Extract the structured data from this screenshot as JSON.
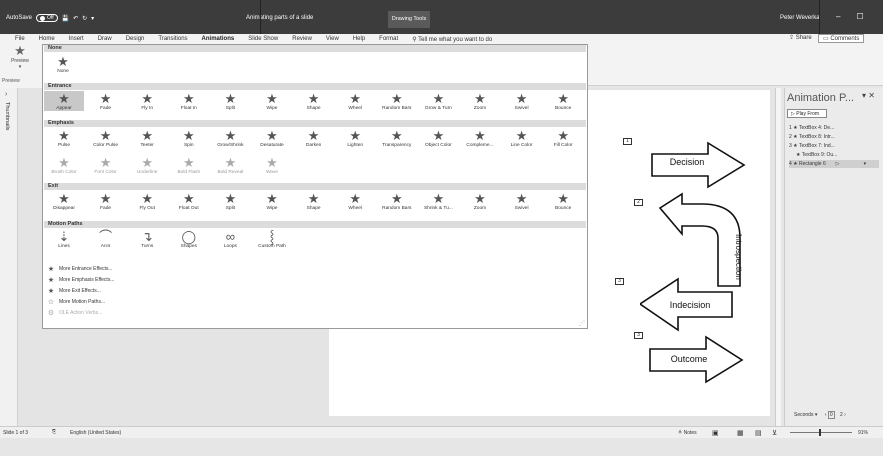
{
  "titlebar": {
    "autosave": "AutoSave",
    "toggle": "Off",
    "doc_title": "Animating parts of a slide",
    "drawing_tools": "Drawing Tools",
    "user": "Peter Weverka"
  },
  "menu": {
    "items": [
      "File",
      "Home",
      "Insert",
      "Draw",
      "Design",
      "Transitions",
      "Animations",
      "Slide Show",
      "Review",
      "View",
      "Help",
      "Format"
    ],
    "tell_me": "Tell me what you want to do",
    "share": "Share",
    "comments": "Comments"
  },
  "ribbon": {
    "preview": "Preview",
    "preview_group": "Preview"
  },
  "gallery": {
    "sections": {
      "none": "None",
      "entrance": "Entrance",
      "emphasis": "Emphasis",
      "exit": "Exit",
      "motion_paths": "Motion Paths"
    },
    "none_label": "None",
    "entrance": [
      "Appear",
      "Fade",
      "Fly In",
      "Float In",
      "Split",
      "Wipe",
      "Shape",
      "Wheel",
      "Random Bars",
      "Grow & Turn",
      "Zoom",
      "Swivel",
      "Bounce"
    ],
    "emphasis_row1": [
      "Pulse",
      "Color Pulse",
      "Teeter",
      "Spin",
      "Grow/Shrink",
      "Desaturate",
      "Darken",
      "Lighten",
      "Transparency",
      "Object Color",
      "Compleme...",
      "Line Color",
      "Fill Color"
    ],
    "emphasis_row2": [
      "Brush Color",
      "Font Color",
      "Underline",
      "Bold Flash",
      "Bold Reveal",
      "Wave"
    ],
    "exit": [
      "Disappear",
      "Fade",
      "Fly Out",
      "Float Out",
      "Split",
      "Wipe",
      "Shape",
      "Wheel",
      "Random Bars",
      "Shrink & Tu...",
      "Zoom",
      "Swivel",
      "Bounce"
    ],
    "motion_paths": [
      "Lines",
      "Arcs",
      "Turns",
      "Shapes",
      "Loops",
      "Custom Path"
    ],
    "more": [
      "More Entrance Effects...",
      "More Emphasis Effects...",
      "More Exit Effects...",
      "More Motion Paths...",
      "OLE Action Verbs..."
    ]
  },
  "slide": {
    "numbers": [
      "1",
      "2",
      "3",
      "3"
    ],
    "shapes": [
      "Decision",
      "Introspection",
      "Indecision",
      "Outcome"
    ]
  },
  "animation_pane": {
    "title": "Animation P...",
    "play_from": "Play From",
    "items": [
      "1 ★ TextBox 4: De...",
      "2 ★ TextBox 8: Intr...",
      "3 ★ TextBox 7: Ind...",
      "★ TextBox 9: Ou...",
      "4 ★ Rectangle 6"
    ],
    "seconds": "Seconds",
    "timeline": [
      "0",
      "2"
    ]
  },
  "status": {
    "slide": "Slide 1 of 3",
    "language": "English (United States)",
    "notes": "Notes",
    "zoom": "91%"
  }
}
